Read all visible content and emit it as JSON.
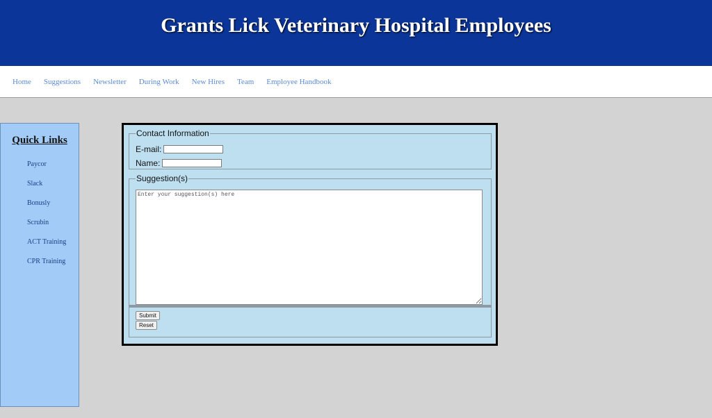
{
  "header": {
    "title": "Grants Lick Veterinary Hospital Employees"
  },
  "nav": {
    "items": [
      {
        "label": "Home"
      },
      {
        "label": "Suggestions"
      },
      {
        "label": "Newsletter"
      },
      {
        "label": "During Work"
      },
      {
        "label": "New Hires"
      },
      {
        "label": "Team"
      },
      {
        "label": "Employee Handbook"
      }
    ]
  },
  "sidebar": {
    "title": "Quick Links",
    "items": [
      {
        "label": "Paycor"
      },
      {
        "label": "Slack"
      },
      {
        "label": "Bonusly"
      },
      {
        "label": "Scrubin"
      },
      {
        "label": "ACT Training"
      },
      {
        "label": "CPR Training"
      }
    ]
  },
  "form": {
    "contact_legend": "Contact Information",
    "email_label": "E-mail:",
    "email_value": "",
    "name_label": "Name:",
    "name_value": "",
    "suggestion_legend": "Suggestion(s)",
    "suggestion_placeholder": "Enter your suggestion(s) here",
    "submit_label": "Submit",
    "reset_label": "Reset"
  },
  "colors": {
    "header_bg": "#0b3599",
    "nav_link": "#5a8ad4",
    "sidebar_bg": "#a3cbf7",
    "form_bg": "#bddff0",
    "page_bg": "#d3d3d3"
  }
}
